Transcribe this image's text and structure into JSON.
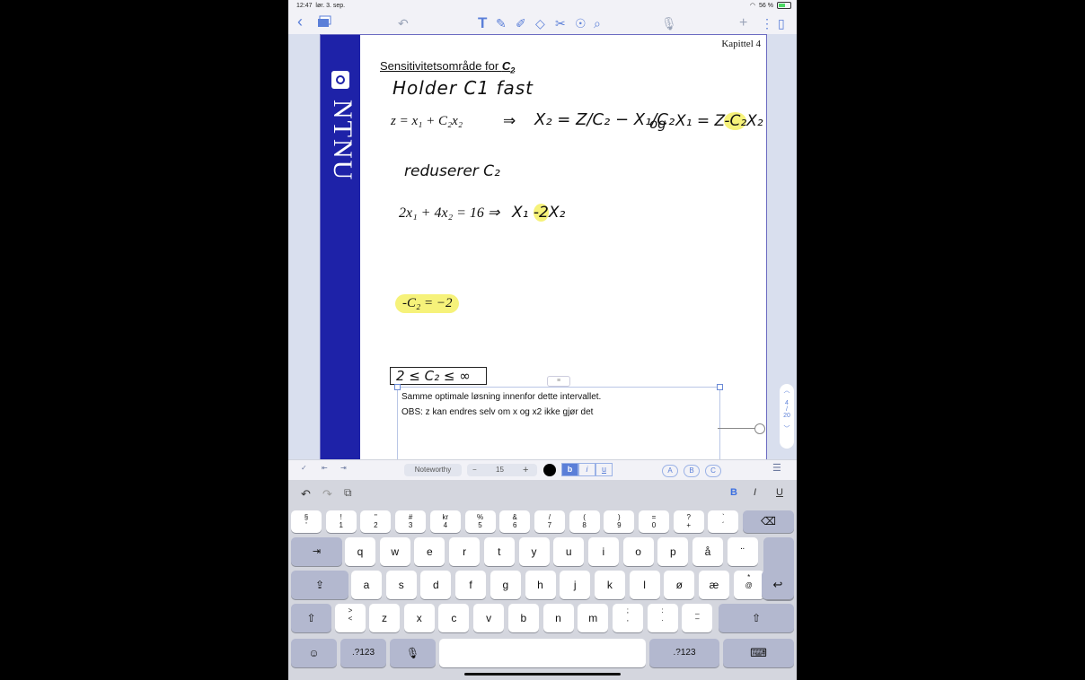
{
  "status": {
    "time": "12:47",
    "date": "lør. 3. sep.",
    "battery": "56 %",
    "battery_level": 0.56
  },
  "toolbar": {
    "back": "‹",
    "icons": [
      "pages-icon",
      "undo-icon",
      "text-tool-icon",
      "pen-icon",
      "highlighter-icon",
      "eraser-icon",
      "lasso-icon",
      "shapes-icon",
      "zoom-icon",
      "mic-icon",
      "add-icon",
      "more-icon",
      "sidebar-icon"
    ]
  },
  "page": {
    "chapter": "Kapittel 4",
    "title_text": "Sensitivitetsområde for ",
    "title_var": "C",
    "title_sub": "2",
    "logo_text": "NTNU",
    "hand_line1": "Holder C1 fast",
    "eq1_lhs": "z = x₁ + C₂x₂",
    "arrow": "⇒",
    "eq1_rhs": "X₂ = Z/C₂ − X₁/C₂",
    "og": "og",
    "eq1_tail_pre": "X₁ = Z",
    "eq1_tail_hl": "-C₂",
    "eq1_tail_post": "X₂",
    "hand_reduce": "reduserer C₂",
    "eq2_lhs": "2x₁ + 4x₂ = 16 ⇒",
    "eq2_pre": "X₁",
    "eq2_hl": "-2",
    "eq2_post": "X₂",
    "eq3": "-C₂ = −2",
    "interval": "2 ≤ C₂ ≤ ∞",
    "textbox_line1": "Samme optimale løsning innenfor dette intervallet.",
    "textbox_line2": "OBS: z kan endres selv om x og x2 ikke gjør det"
  },
  "pager": {
    "current": "4",
    "sep": "/",
    "total": "20"
  },
  "format": {
    "font": "Noteworthy",
    "minus": "−",
    "size": "15",
    "plus": "+",
    "bold": "b",
    "italic": "i",
    "underline": "u",
    "styleA": "A",
    "styleB": "B",
    "styleC": "C",
    "color": "#000000"
  },
  "keyboard": {
    "sugg_bold": "B",
    "sugg_italic": "I",
    "sugg_underline": "U",
    "row1": [
      [
        "§",
        "'"
      ],
      [
        "!",
        "1"
      ],
      [
        "\"",
        "2"
      ],
      [
        "#",
        "3"
      ],
      [
        "kr",
        "4"
      ],
      [
        "%",
        "5"
      ],
      [
        "&",
        "6"
      ],
      [
        "/",
        "7"
      ],
      [
        "(",
        "8"
      ],
      [
        ")",
        "9"
      ],
      [
        "=",
        "0"
      ],
      [
        "?",
        "+"
      ],
      [
        "`",
        "´"
      ]
    ],
    "row2": [
      "q",
      "w",
      "e",
      "r",
      "t",
      "y",
      "u",
      "i",
      "o",
      "p",
      "å",
      "¨"
    ],
    "row3": [
      "a",
      "s",
      "d",
      "f",
      "g",
      "h",
      "j",
      "k",
      "l",
      "ø",
      "æ"
    ],
    "row3_last": [
      "*",
      "@"
    ],
    "row4": [
      "z",
      "x",
      "c",
      "v",
      "b",
      "n",
      "m"
    ],
    "row4_gt": [
      ">",
      "<"
    ],
    "row4_punct": [
      [
        ";",
        ","
      ],
      [
        ":",
        "."
      ],
      [
        "_",
        "–"
      ]
    ],
    "num_left": ".?123",
    "num_right": ".?123"
  }
}
